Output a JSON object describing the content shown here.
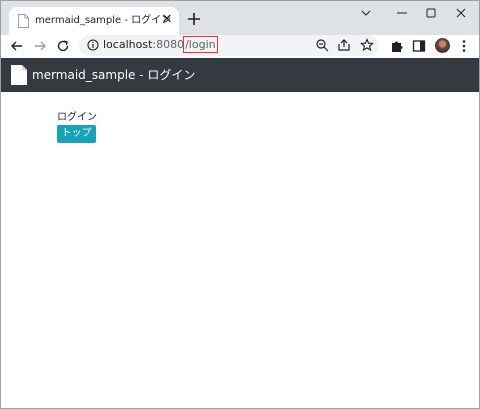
{
  "browser": {
    "tab": {
      "title": "mermaid_sample - ログイン",
      "close_glyph": "✕"
    },
    "new_tab_icon": "plus-icon",
    "window_controls": [
      "chevron-down-icon",
      "minimize-icon",
      "maximize-icon",
      "close-icon"
    ],
    "toolbar": {
      "nav_icons": [
        "back-arrow-icon",
        "forward-arrow-icon",
        "reload-icon"
      ],
      "address": {
        "host": "localhost",
        "port": ":8080",
        "path": "/login"
      },
      "omnibox_icons": [
        "zoom-icon",
        "share-icon",
        "bookmark-star-icon"
      ],
      "extension_icons": [
        "extensions-puzzle-icon",
        "side-panel-icon",
        "profile-avatar",
        "kebab-menu-icon"
      ]
    }
  },
  "app": {
    "navbar": {
      "icon": "file-icon",
      "title": "mermaid_sample - ログイン"
    },
    "page": {
      "heading": "ログイン",
      "top_button_label": "トップ"
    }
  },
  "colors": {
    "tabstrip_bg": "#dee1e6",
    "navbar_bg": "#343a40",
    "button_bg": "#17a2b8",
    "url_highlight": "#e53935"
  }
}
